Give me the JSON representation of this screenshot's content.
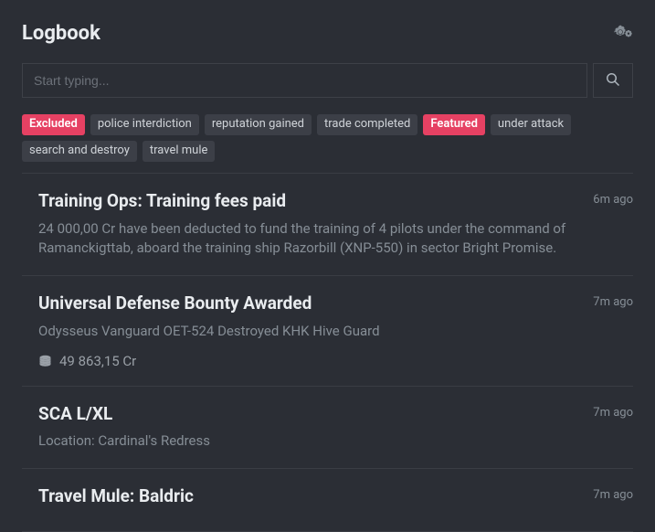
{
  "header": {
    "title": "Logbook"
  },
  "search": {
    "placeholder": "Start typing..."
  },
  "tags": [
    {
      "label": "Excluded",
      "style": "special"
    },
    {
      "label": "police interdiction",
      "style": "default"
    },
    {
      "label": "reputation gained",
      "style": "default"
    },
    {
      "label": "trade completed",
      "style": "default"
    },
    {
      "label": "Featured",
      "style": "special"
    },
    {
      "label": "under attack",
      "style": "default"
    },
    {
      "label": "search and destroy",
      "style": "default"
    },
    {
      "label": "travel mule",
      "style": "default"
    }
  ],
  "entries": [
    {
      "title": "Training Ops: Training fees paid",
      "time": "6m ago",
      "body": "24 000,00 Cr have been deducted to fund the training of 4 pilots under the command of Ramanckigttab, aboard the training ship Razorbill (XNP-550) in sector Bright Promise."
    },
    {
      "title": "Universal Defense Bounty Awarded",
      "time": "7m ago",
      "body": "Odysseus Vanguard OET-524 Destroyed KHK Hive Guard",
      "amount": "49 863,15 Cr"
    },
    {
      "title": "SCA L/XL",
      "time": "7m ago",
      "body": "Location: Cardinal's Redress"
    },
    {
      "title": "Travel Mule: Baldric",
      "time": "7m ago",
      "body": ""
    }
  ]
}
